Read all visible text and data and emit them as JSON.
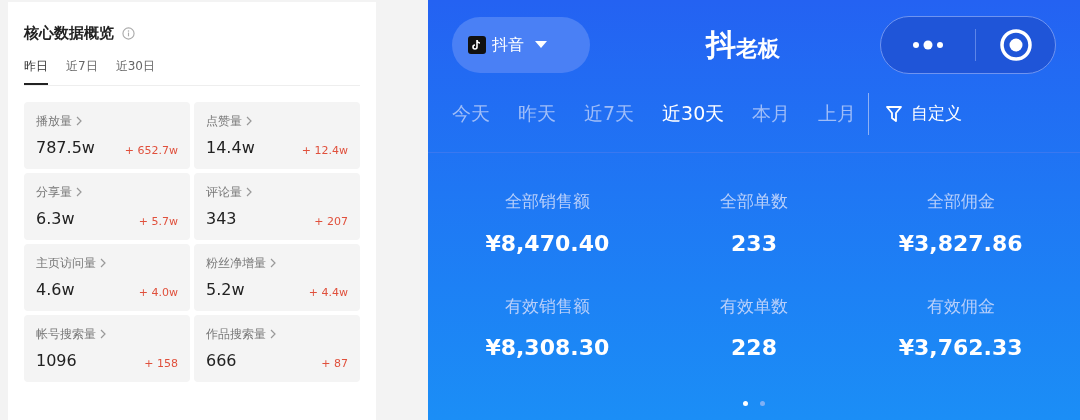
{
  "overview": {
    "title": "核心数据概览",
    "tabs": [
      {
        "label": "昨日",
        "selected": true
      },
      {
        "label": "近7日",
        "selected": false
      },
      {
        "label": "近30日",
        "selected": false
      }
    ],
    "metrics": [
      {
        "label": "播放量",
        "value": "787.5w",
        "change": "+ 652.7w"
      },
      {
        "label": "点赞量",
        "value": "14.4w",
        "change": "+ 12.4w"
      },
      {
        "label": "分享量",
        "value": "6.3w",
        "change": "+ 5.7w"
      },
      {
        "label": "评论量",
        "value": "343",
        "change": "+ 207"
      },
      {
        "label": "主页访问量",
        "value": "4.6w",
        "change": "+ 4.0w"
      },
      {
        "label": "粉丝净增量",
        "value": "5.2w",
        "change": "+ 4.4w"
      },
      {
        "label": "帐号搜索量",
        "value": "1096",
        "change": "+ 158"
      },
      {
        "label": "作品搜索量",
        "value": "666",
        "change": "+ 87"
      }
    ]
  },
  "app": {
    "platform": "抖音",
    "logo_big": "抖",
    "logo_rest": "老板",
    "ranges": [
      {
        "label": "今天",
        "selected": false
      },
      {
        "label": "昨天",
        "selected": false
      },
      {
        "label": "近7天",
        "selected": false
      },
      {
        "label": "近30天",
        "selected": true
      },
      {
        "label": "本月",
        "selected": false
      },
      {
        "label": "上月",
        "selected": false
      }
    ],
    "custom": "自定义",
    "stats": [
      {
        "label": "全部销售额",
        "value": "¥8,470.40"
      },
      {
        "label": "全部单数",
        "value": "233"
      },
      {
        "label": "全部佣金",
        "value": "¥3,827.86"
      },
      {
        "label": "有效销售额",
        "value": "¥8,308.30"
      },
      {
        "label": "有效单数",
        "value": "228"
      },
      {
        "label": "有效佣金",
        "value": "¥3,762.33"
      }
    ],
    "pages": [
      {
        "selected": true
      },
      {
        "selected": false
      }
    ]
  }
}
